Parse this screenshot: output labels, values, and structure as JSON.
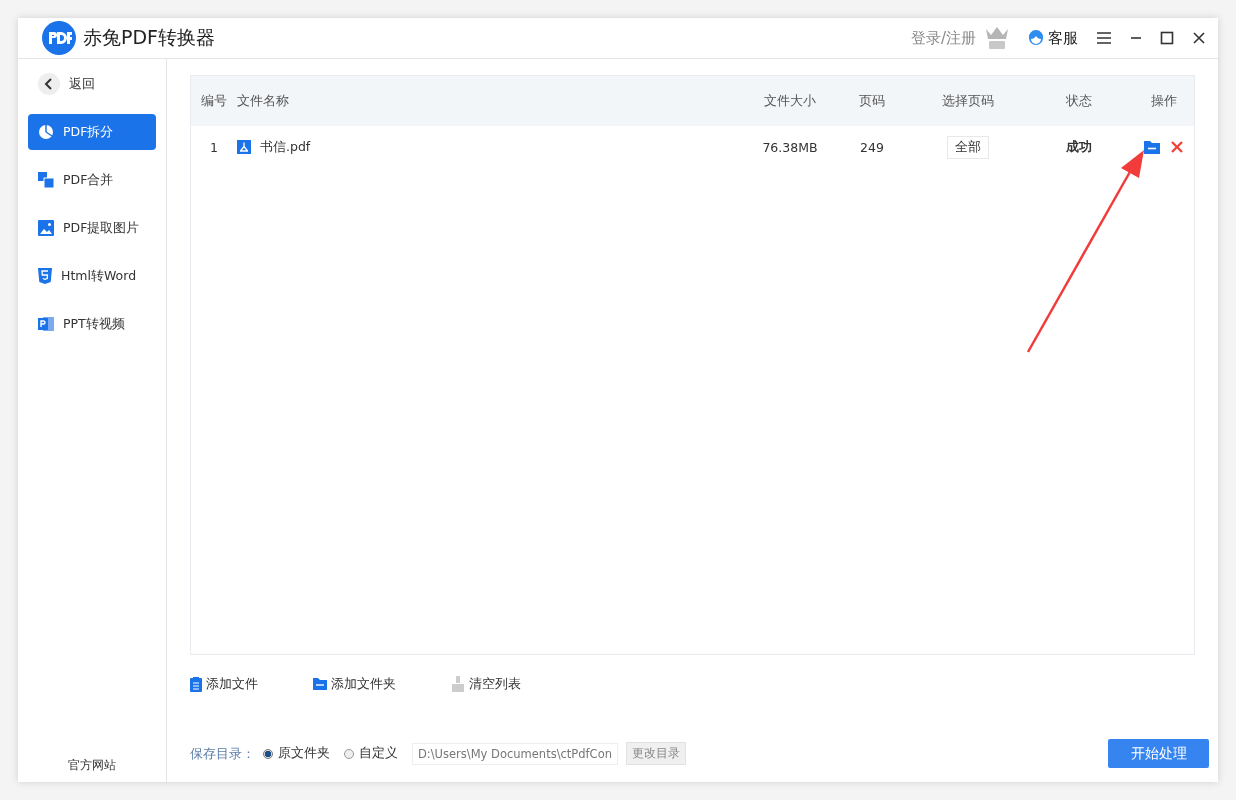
{
  "app": {
    "title": "赤兔PDF转换器"
  },
  "header": {
    "login": "登录/注册",
    "support": "客服"
  },
  "sidebar": {
    "back": "返回",
    "items": [
      {
        "kind": "split",
        "label": "PDF拆分",
        "selected": true
      },
      {
        "kind": "merge",
        "label": "PDF合并",
        "selected": false
      },
      {
        "kind": "image",
        "label": "PDF提取图片",
        "selected": false
      },
      {
        "kind": "html",
        "label": "Html转Word",
        "selected": false
      },
      {
        "kind": "ppt",
        "label": "PPT转视频",
        "selected": false
      }
    ],
    "footer": "官方网站"
  },
  "table": {
    "columns": [
      "编号",
      "文件名称",
      "文件大小",
      "页码",
      "选择页码",
      "状态",
      "操作"
    ],
    "rows": [
      {
        "index": "1",
        "name": "书信.pdf",
        "size": "76.38MB",
        "pages": "249",
        "page_select": "全部",
        "status": "成功"
      }
    ]
  },
  "toolbar": [
    {
      "kind": "add-file",
      "label": "添加文件",
      "disabled": false
    },
    {
      "kind": "add-folder",
      "label": "添加文件夹",
      "disabled": false
    },
    {
      "kind": "clear",
      "label": "清空列表",
      "disabled": true
    }
  ],
  "save": {
    "label": "保存目录：",
    "options": [
      {
        "label": "原文件夹",
        "selected": true
      },
      {
        "label": "自定义",
        "selected": false
      }
    ],
    "path": "D:\\Users\\My Documents\\ctPdfCon",
    "change_button": "更改目录"
  },
  "start_button": "开始处理"
}
